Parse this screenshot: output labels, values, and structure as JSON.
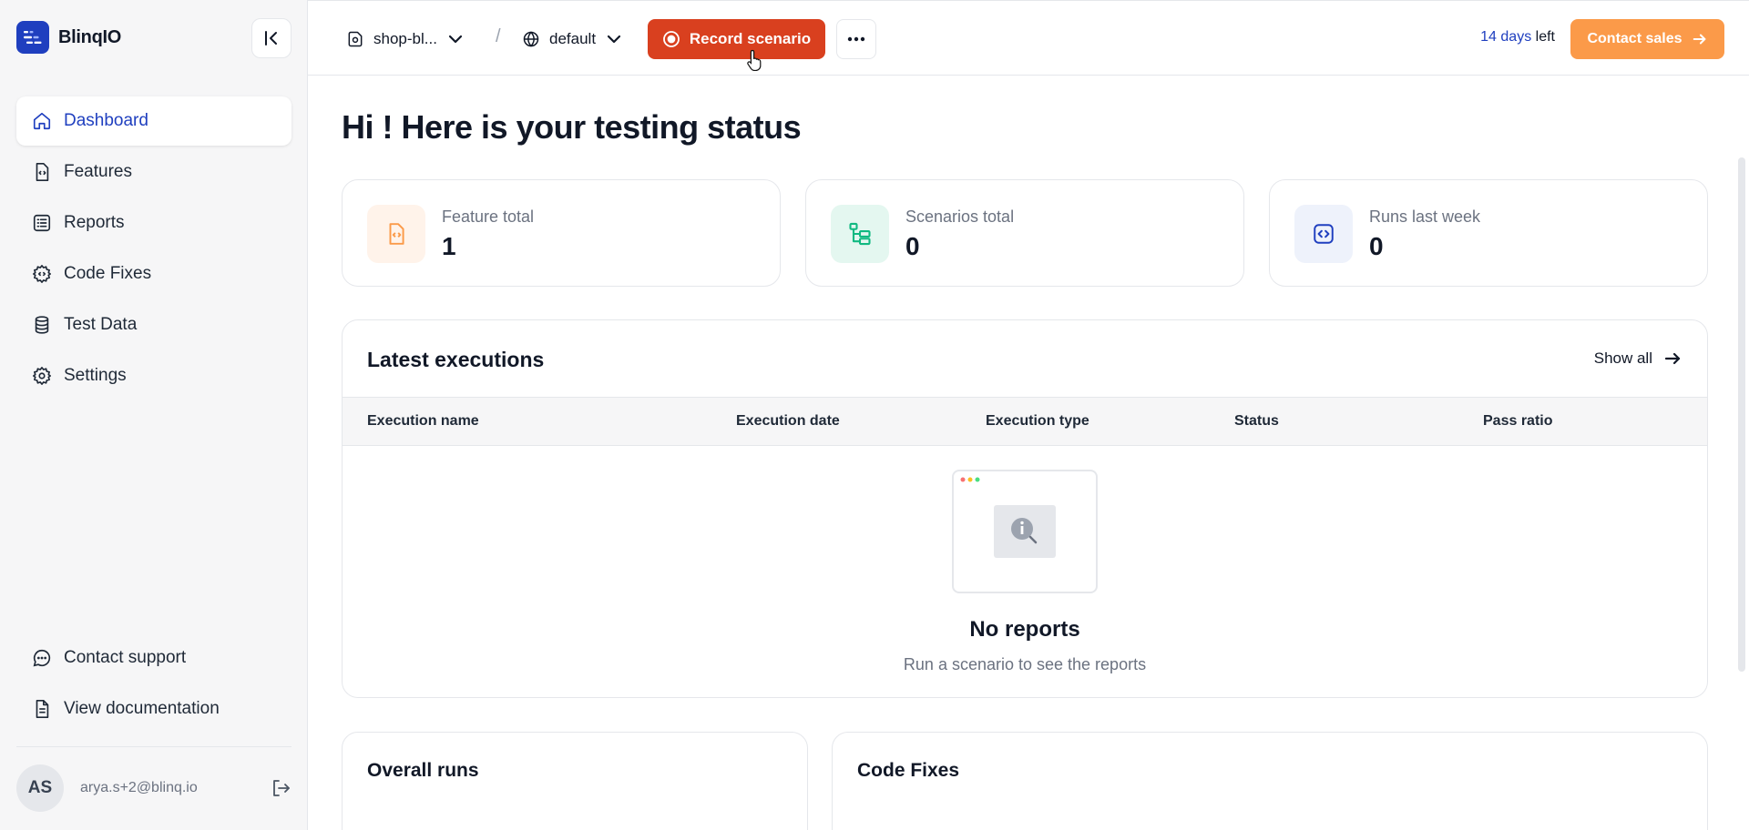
{
  "brand": {
    "name": "BlinqIO"
  },
  "sidebar": {
    "items": [
      {
        "label": "Dashboard",
        "icon": "home-icon"
      },
      {
        "label": "Features",
        "icon": "feature-file-icon"
      },
      {
        "label": "Reports",
        "icon": "list-icon"
      },
      {
        "label": "Code Fixes",
        "icon": "code-gear-icon"
      },
      {
        "label": "Test Data",
        "icon": "database-icon"
      },
      {
        "label": "Settings",
        "icon": "gear-icon"
      }
    ],
    "bottom": [
      {
        "label": "Contact support",
        "icon": "chat-icon"
      },
      {
        "label": "View documentation",
        "icon": "document-icon"
      }
    ],
    "user": {
      "initials": "AS",
      "email": "arya.s+2@blinq.io"
    }
  },
  "topbar": {
    "project": "shop-bl...",
    "environment": "default",
    "record_label": "Record scenario",
    "trial_days": "14 days",
    "trial_suffix": " left",
    "contact_label": "Contact sales"
  },
  "main": {
    "greeting": "Hi ! Here is your testing status",
    "stats": [
      {
        "label": "Feature total",
        "value": "1"
      },
      {
        "label": "Scenarios total",
        "value": "0"
      },
      {
        "label": "Runs last week",
        "value": "0"
      }
    ],
    "executions": {
      "title": "Latest executions",
      "show_all": "Show all",
      "columns": [
        "Execution name",
        "Execution date",
        "Execution type",
        "Status",
        "Pass ratio"
      ],
      "empty_title": "No reports",
      "empty_subtitle": "Run a scenario to see the reports"
    },
    "overall_runs": "Overall runs",
    "code_fixes": "Code Fixes"
  },
  "colors": {
    "accent": "#1f3fbf",
    "record": "#d9401f",
    "contact": "#fb9a49"
  }
}
